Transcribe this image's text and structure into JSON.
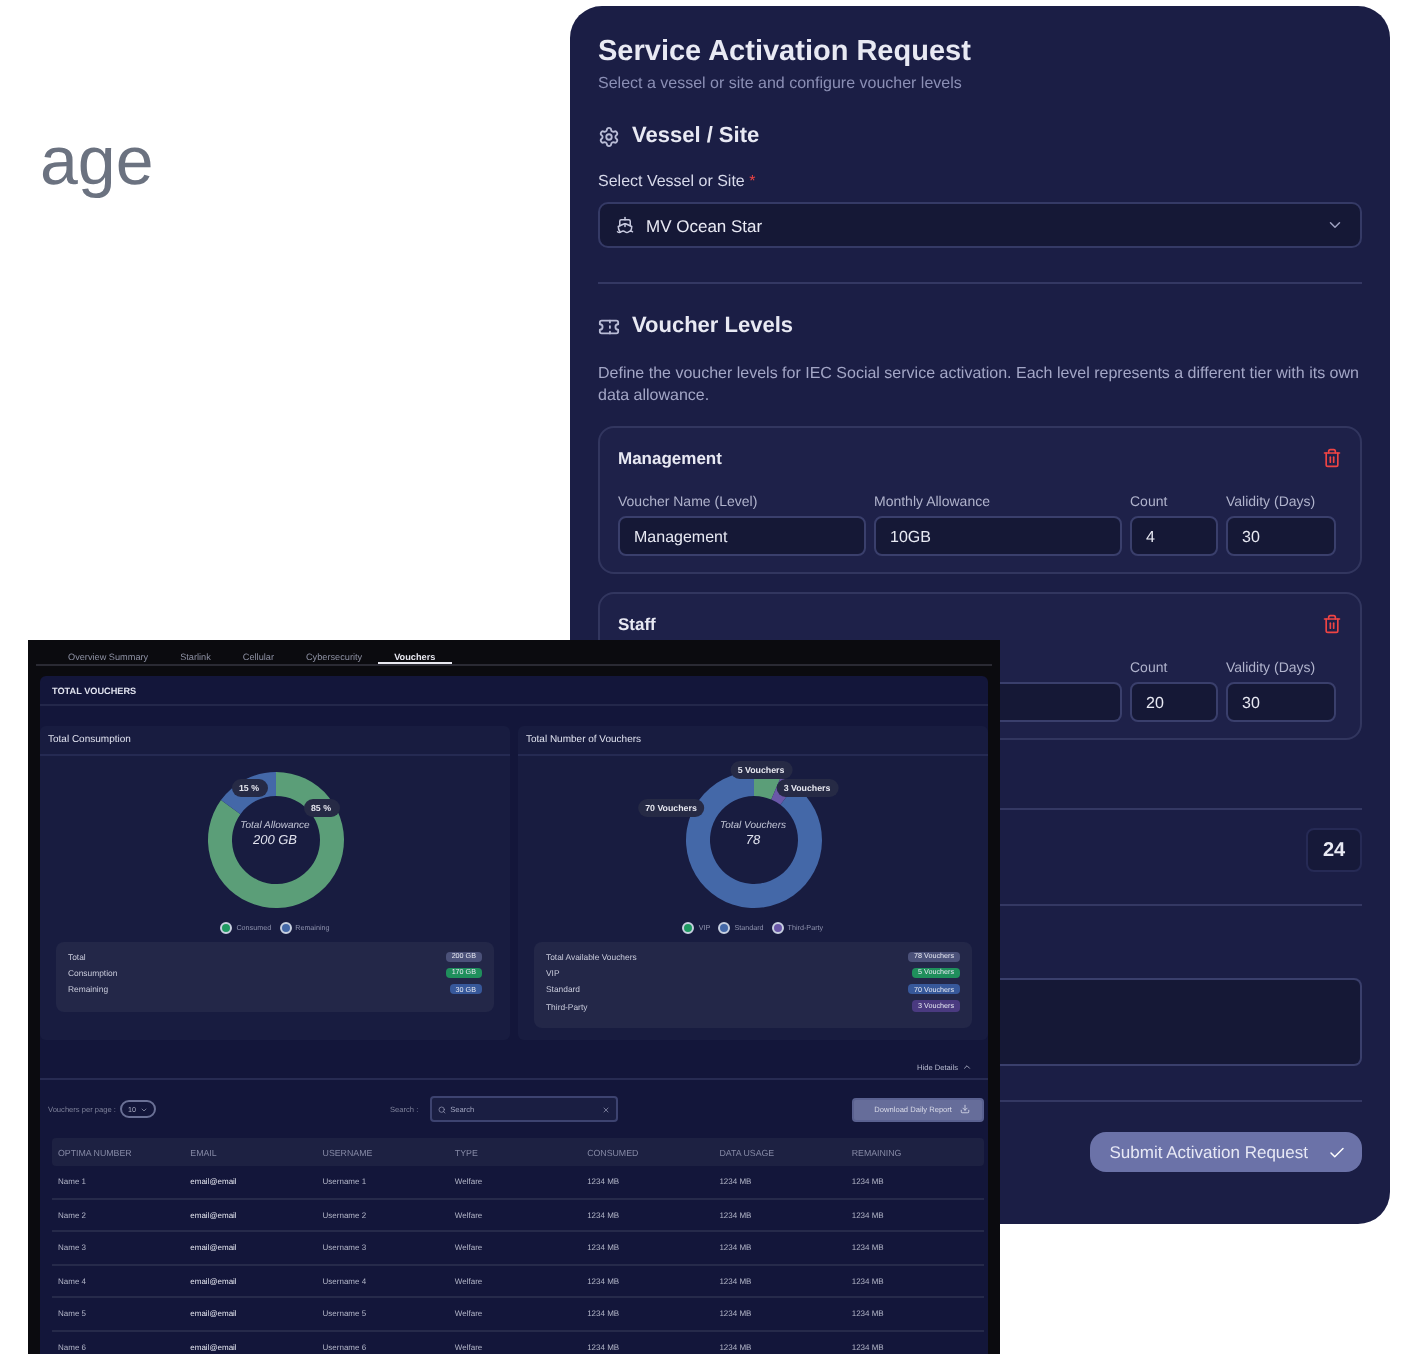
{
  "background_text": "age",
  "form": {
    "title": "Service Activation Request",
    "subtitle": "Select a vessel or site and configure voucher levels",
    "vessel_section": {
      "heading": "Vessel / Site",
      "field_label": "Select Vessel or Site",
      "required_mark": "*",
      "value": "MV Ocean Star"
    },
    "voucher_section": {
      "heading": "Voucher Levels",
      "description": "Define the voucher levels for IEC Social service activation. Each level represents a different tier with its own data allowance.",
      "levels": [
        {
          "title": "Management",
          "fields": [
            {
              "label": "Voucher Name (Level)",
              "value": "Management"
            },
            {
              "label": "Monthly Allowance",
              "value": "10GB"
            },
            {
              "label": "Count",
              "value": "4"
            },
            {
              "label": "Validity (Days)",
              "value": "30"
            }
          ]
        },
        {
          "title": "Staff",
          "fields": [
            {
              "label": "Count",
              "value": "20"
            },
            {
              "label": "Validity (Days)",
              "value": "30"
            }
          ]
        }
      ]
    },
    "number_field": {
      "value": "24"
    },
    "submit_button": "Submit Activation Request"
  },
  "dashboard": {
    "tabs": [
      {
        "label": "Overview Summary",
        "selected": false
      },
      {
        "label": "Starlink",
        "selected": false
      },
      {
        "label": "Cellular",
        "selected": false
      },
      {
        "label": "Cybersecurity",
        "selected": false
      },
      {
        "label": "Vouchers",
        "selected": true
      }
    ],
    "section_title": "TOTAL VOUCHERS",
    "cards": [
      {
        "title": "Total Consumption",
        "center_label": "Total Allowance",
        "center_value": "200 GB",
        "chart_data": {
          "type": "donut",
          "categories": [
            "Consumed",
            "Remaining"
          ],
          "values": [
            85,
            15
          ],
          "value_labels": [
            "85 %",
            "15 %"
          ]
        },
        "summary": [
          {
            "label": "Total",
            "value": "200 GB",
            "color": "#4b5179"
          },
          {
            "label": "Consumption",
            "value": "170 GB",
            "color": "#1f8f5c"
          },
          {
            "label": "Remaining",
            "value": "30 GB",
            "color": "#37589a"
          }
        ]
      },
      {
        "title": "Total Number of Vouchers",
        "center_label": "Total Vouchers",
        "center_value": "78",
        "chart_data": {
          "type": "donut",
          "categories": [
            "VIP",
            "Standard",
            "Third-Party"
          ],
          "values": [
            5,
            70,
            3
          ],
          "value_labels": [
            "5 Vouchers",
            "70 Vouchers",
            "3 Vouchers"
          ]
        },
        "summary": [
          {
            "label": "Total Available Vouchers",
            "value": "78 Vouchers",
            "color": "#4b5179"
          },
          {
            "label": "VIP",
            "value": "5 Vouchers",
            "color": "#1f8f5c"
          },
          {
            "label": "Standard",
            "value": "70 Vouchers",
            "color": "#37589a"
          },
          {
            "label": "Third-Party",
            "value": "3 Vouchers",
            "color": "#4a3a80"
          }
        ]
      }
    ],
    "hide_details": "Hide Details",
    "per_page_label": "Vouchers per page :",
    "per_page_value": "10",
    "search_label": "Search :",
    "search_placeholder": "Search",
    "download_button": "Download Daily Report",
    "table": {
      "columns": [
        "OPTIMA NUMBER",
        "EMAIL",
        "USERNAME",
        "TYPE",
        "CONSUMED",
        "DATA USAGE",
        "REMAINING"
      ],
      "rows": [
        [
          "Name 1",
          "email@email",
          "Username 1",
          "Welfare",
          "1234 MB",
          "1234 MB",
          "1234 MB"
        ],
        [
          "Name 2",
          "email@email",
          "Username 2",
          "Welfare",
          "1234 MB",
          "1234 MB",
          "1234 MB"
        ],
        [
          "Name 3",
          "email@email",
          "Username 3",
          "Welfare",
          "1234 MB",
          "1234 MB",
          "1234 MB"
        ],
        [
          "Name 4",
          "email@email",
          "Username 4",
          "Welfare",
          "1234 MB",
          "1234 MB",
          "1234 MB"
        ],
        [
          "Name 5",
          "email@email",
          "Username 5",
          "Welfare",
          "1234 MB",
          "1234 MB",
          "1234 MB"
        ],
        [
          "Name 6",
          "email@email",
          "Username 6",
          "Welfare",
          "1234 MB",
          "1234 MB",
          "1234 MB"
        ]
      ]
    }
  }
}
